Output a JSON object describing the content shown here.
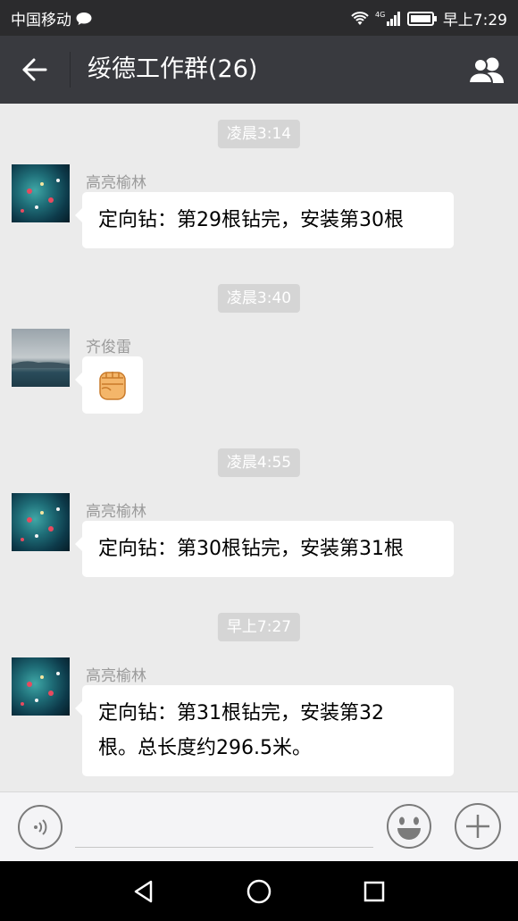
{
  "status_bar": {
    "carrier": "中国移动",
    "network": "4G",
    "time": "早上7:29"
  },
  "header": {
    "title": "绥德工作群(26)"
  },
  "messages": [
    {
      "time_label": "凌晨3:14",
      "sender": "高亮榆林",
      "text": "定向钻：第29根钻完，安装第30根"
    },
    {
      "time_label": "凌晨3:40",
      "sender": "齐俊雷",
      "emoji": "fist-emoji"
    },
    {
      "time_label": "凌晨4:55",
      "sender": "高亮榆林",
      "text": "定向钻：第30根钻完，安装第31根"
    },
    {
      "time_label": "早上7:27",
      "sender": "高亮榆林",
      "text_line1": "定向钻：第31根钻完，安装第32",
      "text_line2": "根。总长度约296.5米。"
    }
  ],
  "input_bar": {
    "placeholder": ""
  },
  "colors": {
    "header_bg": "#393a3f",
    "status_bg": "#2b2b2d",
    "chat_bg": "#ebebeb",
    "bubble_bg": "#ffffff",
    "time_pill_bg": "#d5d5d5"
  }
}
